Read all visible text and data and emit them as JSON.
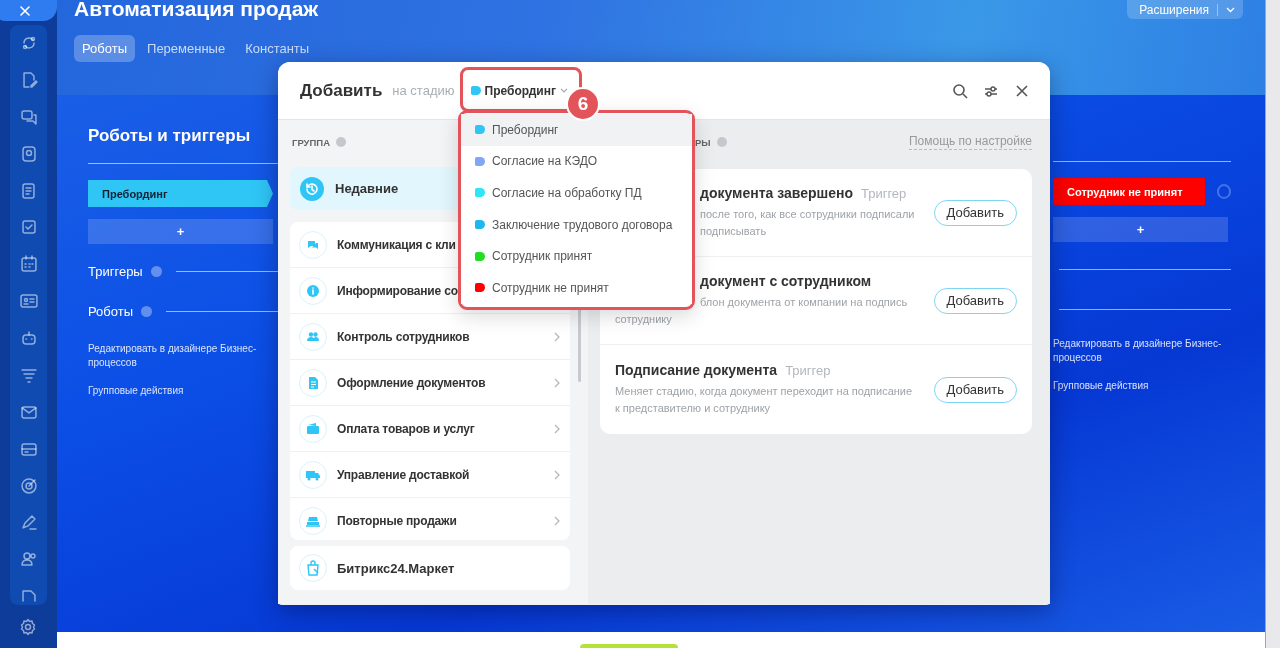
{
  "header": {
    "title": "Автоматизация продаж",
    "extensions_button": "Расширения",
    "tabs": [
      {
        "label": "Роботы",
        "selected": true
      },
      {
        "label": "Переменные",
        "selected": false
      },
      {
        "label": "Константы",
        "selected": false
      }
    ]
  },
  "board": {
    "section_title": "Роботы и триггеры",
    "columns": [
      {
        "stage": "Пребординг",
        "color": "#2fc6f6",
        "add_label": "+",
        "triggers_label": "Триггеры",
        "robots_label": "Роботы",
        "links": [
          "Редактировать в дизайнере Бизнес-процессов",
          "Групповые действия"
        ]
      },
      {
        "stage": "Сотрудник не принят",
        "color": "#ff0000",
        "add_label": "+",
        "links": [
          "Редактировать в дизайнере Бизнес-процессов",
          "Групповые действия"
        ]
      }
    ]
  },
  "modal": {
    "title": "Добавить",
    "stage_prefix": "на стадию",
    "stage": {
      "label": "Пребординг",
      "color": "#2fc6f6"
    },
    "callout": "6",
    "group_heading": "ГРУППА",
    "recent": {
      "label": "Недавние",
      "selected": true
    },
    "groups": [
      {
        "label": "Коммуникация с кли",
        "selected": false
      },
      {
        "label": "Информирование со",
        "selected": false
      },
      {
        "label": "Контроль сотрудников",
        "selected": false
      },
      {
        "label": "Оформление документов",
        "selected": false
      },
      {
        "label": "Оплата товаров и услуг",
        "selected": false
      },
      {
        "label": "Управление доставкой",
        "selected": false
      },
      {
        "label": "Повторные продажи",
        "selected": false
      }
    ],
    "market": "Битрикс24.Маркет",
    "list_heading": "РЫ",
    "help_link": "Помощь по настройке",
    "items": [
      {
        "title": "документа завершено",
        "tag": "Триггер",
        "lines": [
          "после того, как все сотрудники подписали",
          "подписывать"
        ],
        "button": "Добавить"
      },
      {
        "title": "документ с сотрудником",
        "lines": [
          "блон документа от компании на подпись",
          "сотруднику"
        ],
        "button": "Добавить"
      },
      {
        "title": "Подписание документа",
        "tag": "Триггер",
        "lines": [
          "Меняет стадию, когда документ переходит на подписание",
          "к представителю и сотруднику"
        ],
        "button": "Добавить"
      }
    ],
    "stage_menu": [
      {
        "label": "Пребординг",
        "color": "#2fc6f6",
        "selected": true
      },
      {
        "label": "Согласие на КЭДО",
        "color": "#7fa6f7",
        "selected": false
      },
      {
        "label": "Согласие на обработку ПД",
        "color": "#2ee6f6",
        "selected": false
      },
      {
        "label": "Заключение трудового договора",
        "color": "#1fb8ee",
        "selected": false
      },
      {
        "label": "Сотрудник принят",
        "color": "#22dd22",
        "selected": false
      },
      {
        "label": "Сотрудник не принят",
        "color": "#ff0000",
        "selected": false
      }
    ]
  }
}
